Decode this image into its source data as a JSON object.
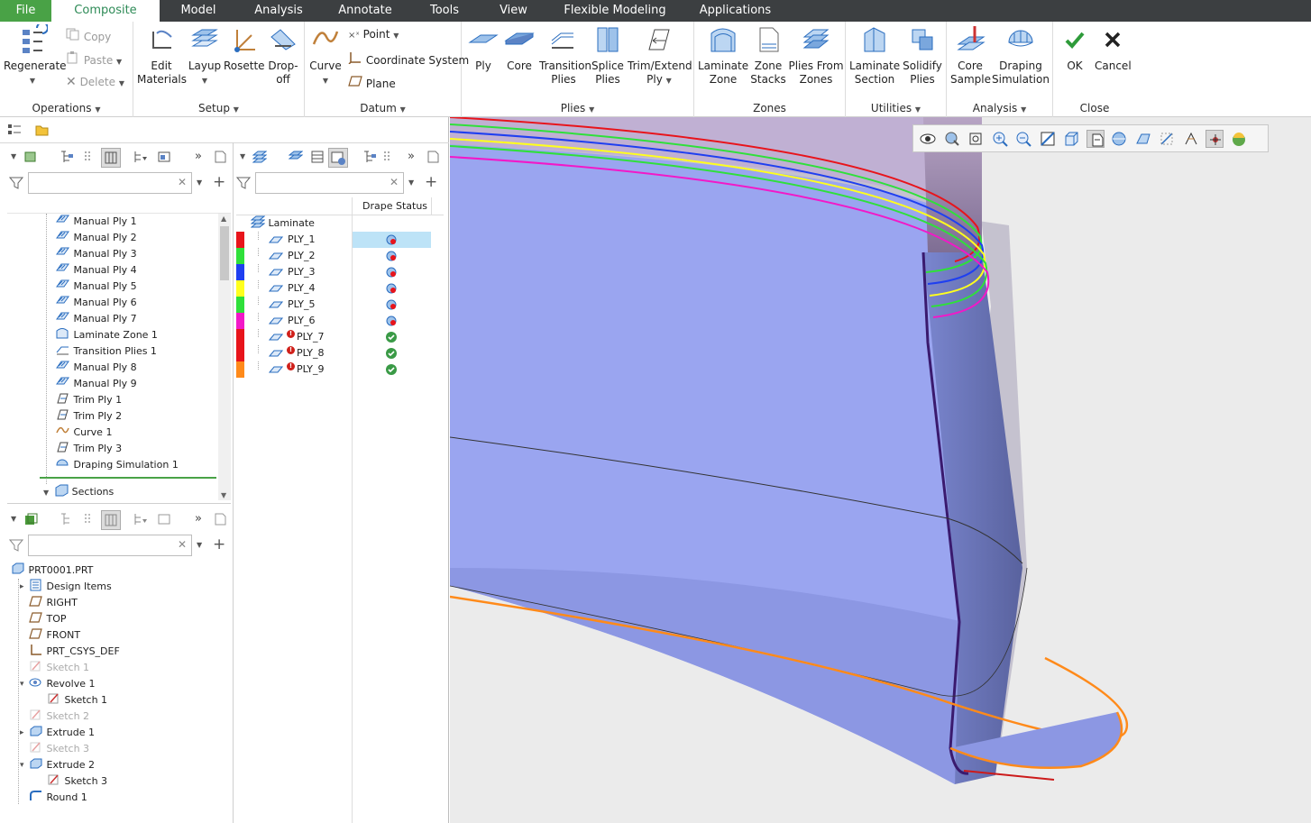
{
  "menu": {
    "file": "File",
    "tabs": [
      "Composite",
      "Model",
      "Analysis",
      "Annotate",
      "Tools",
      "View",
      "Flexible Modeling",
      "Applications"
    ]
  },
  "ribbon": {
    "operations": {
      "label": "Operations",
      "regenerate": "Regenerate",
      "copy": "Copy",
      "paste": "Paste",
      "delete": "Delete"
    },
    "setup": {
      "label": "Setup",
      "edit_materials_1": "Edit",
      "edit_materials_2": "Materials",
      "layup": "Layup",
      "rosette": "Rosette",
      "dropoff_1": "Drop-",
      "dropoff_2": "off"
    },
    "datum": {
      "label": "Datum",
      "curve": "Curve",
      "point": "Point",
      "csys": "Coordinate System",
      "plane": "Plane"
    },
    "plies": {
      "label": "Plies",
      "ply": "Ply",
      "core": "Core",
      "transition_1": "Transition",
      "transition_2": "Plies",
      "splice_1": "Splice",
      "splice_2": "Plies",
      "trim_1": "Trim/Extend",
      "trim_2": "Ply"
    },
    "zones": {
      "label": "Zones",
      "laminate_zone_1": "Laminate",
      "laminate_zone_2": "Zone",
      "zone_stacks_1": "Zone",
      "zone_stacks_2": "Stacks",
      "plies_from_1": "Plies From",
      "plies_from_2": "Zones"
    },
    "utilities": {
      "label": "Utilities",
      "lam_section_1": "Laminate",
      "lam_section_2": "Section",
      "solidify_1": "Solidify",
      "solidify_2": "Plies"
    },
    "analysis": {
      "label": "Analysis",
      "core_sample_1": "Core",
      "core_sample_2": "Sample",
      "draping_1": "Draping",
      "draping_2": "Simulation"
    },
    "close": {
      "label": "Close",
      "ok": "OK",
      "cancel": "Cancel"
    }
  },
  "ply_tree": [
    {
      "label": "Manual Ply 1",
      "icon": "ply-icon"
    },
    {
      "label": "Manual Ply 2",
      "icon": "ply-icon"
    },
    {
      "label": "Manual Ply 3",
      "icon": "ply-icon"
    },
    {
      "label": "Manual Ply 4",
      "icon": "ply-icon"
    },
    {
      "label": "Manual Ply 5",
      "icon": "ply-icon"
    },
    {
      "label": "Manual Ply 6",
      "icon": "ply-icon"
    },
    {
      "label": "Manual Ply 7",
      "icon": "ply-icon"
    },
    {
      "label": "Laminate Zone 1",
      "icon": "zone-icon"
    },
    {
      "label": "Transition Plies 1",
      "icon": "transition-icon"
    },
    {
      "label": "Manual Ply 8",
      "icon": "ply-icon"
    },
    {
      "label": "Manual Ply 9",
      "icon": "ply-icon"
    },
    {
      "label": "Trim Ply 1",
      "icon": "trim-icon"
    },
    {
      "label": "Trim Ply 2",
      "icon": "trim-icon"
    },
    {
      "label": "Curve 1",
      "icon": "curve-icon"
    },
    {
      "label": "Trim Ply 3",
      "icon": "trim-icon"
    },
    {
      "label": "Draping Simulation 1",
      "icon": "draping-icon"
    }
  ],
  "sections_label": "Sections",
  "laminate": {
    "root": "Laminate",
    "column_header": "Drape Status",
    "plies": [
      {
        "name": "PLY_1",
        "color": "#e8141b",
        "status": "pending",
        "warn": false
      },
      {
        "name": "PLY_2",
        "color": "#2fe03a",
        "status": "pending",
        "warn": false
      },
      {
        "name": "PLY_3",
        "color": "#1f3ff0",
        "status": "pending",
        "warn": false
      },
      {
        "name": "PLY_4",
        "color": "#ffff1e",
        "status": "pending",
        "warn": false
      },
      {
        "name": "PLY_5",
        "color": "#2fe03a",
        "status": "pending",
        "warn": false
      },
      {
        "name": "PLY_6",
        "color": "#f218c8",
        "status": "pending",
        "warn": false
      },
      {
        "name": "PLY_7",
        "color": "#e8141b",
        "status": "ok",
        "warn": true
      },
      {
        "name": "PLY_8",
        "color": "#e8141b",
        "status": "ok",
        "warn": true
      },
      {
        "name": "PLY_9",
        "color": "#ff8a1a",
        "status": "ok",
        "warn": true
      }
    ]
  },
  "model_tree": [
    {
      "label": "PRT0001.PRT",
      "indent": 0,
      "expander": "",
      "icon": "part-icon",
      "dim": false
    },
    {
      "label": "Design Items",
      "indent": 1,
      "expander": "▸",
      "icon": "design-items-icon",
      "dim": false
    },
    {
      "label": "RIGHT",
      "indent": 1,
      "expander": "",
      "icon": "datum-plane-icon",
      "dim": false
    },
    {
      "label": "TOP",
      "indent": 1,
      "expander": "",
      "icon": "datum-plane-icon",
      "dim": false
    },
    {
      "label": "FRONT",
      "indent": 1,
      "expander": "",
      "icon": "datum-plane-icon",
      "dim": false
    },
    {
      "label": "PRT_CSYS_DEF",
      "indent": 1,
      "expander": "",
      "icon": "csys-icon",
      "dim": false
    },
    {
      "label": "Sketch 1",
      "indent": 1,
      "expander": "",
      "icon": "sketch-icon",
      "dim": true
    },
    {
      "label": "Revolve 1",
      "indent": 1,
      "expander": "▾",
      "icon": "revolve-icon",
      "dim": false
    },
    {
      "label": "Sketch 1",
      "indent": 2,
      "expander": "",
      "icon": "sketch-icon",
      "dim": false
    },
    {
      "label": "Sketch 2",
      "indent": 1,
      "expander": "",
      "icon": "sketch-icon",
      "dim": true
    },
    {
      "label": "Extrude 1",
      "indent": 1,
      "expander": "▸",
      "icon": "extrude-icon",
      "dim": false
    },
    {
      "label": "Sketch 3",
      "indent": 1,
      "expander": "",
      "icon": "sketch-icon",
      "dim": true
    },
    {
      "label": "Extrude 2",
      "indent": 1,
      "expander": "▾",
      "icon": "extrude-icon",
      "dim": false
    },
    {
      "label": "Sketch 3",
      "indent": 2,
      "expander": "",
      "icon": "sketch-icon",
      "dim": false
    },
    {
      "label": "Round 1",
      "indent": 1,
      "expander": "",
      "icon": "round-icon",
      "dim": false
    }
  ],
  "view_toolbar": [
    "eye-icon",
    "saved-views-icon",
    "refit-icon",
    "zoom-in-icon",
    "zoom-out-icon",
    "repaint-icon",
    "display-style-icon",
    "saved-orientations-icon",
    "view-manager-icon",
    "perspective-icon",
    "datum-display-icon",
    "annotation-display-icon",
    "spin-center-icon",
    "appearance-icon"
  ],
  "colors": {
    "accent": "#49a246",
    "menubar": "#3c3f41",
    "surface": "#8f9ff0",
    "edge": "#ff8a1a"
  }
}
